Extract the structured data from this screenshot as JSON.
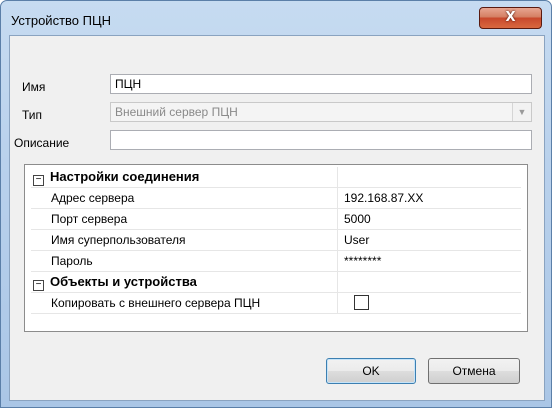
{
  "window": {
    "title": "Устройство ПЦН",
    "close_glyph": "X",
    "close_icon": "close-icon"
  },
  "form": {
    "name_label": "Имя",
    "name_value": "ПЦН",
    "type_label": "Тип",
    "type_value": "Внешний сервер ПЦН",
    "dropdown_glyph": "▼",
    "description_label": "Описание",
    "description_value": ""
  },
  "properties": {
    "categories": [
      {
        "toggle": "−",
        "title": "Настройки соединения"
      },
      {
        "toggle": "−",
        "title": "Объекты и устройства"
      }
    ],
    "connection_rows": [
      {
        "name": "Адрес сервера",
        "value": "192.168.87.XX"
      },
      {
        "name": "Порт сервера",
        "value": "5000"
      },
      {
        "name": "Имя суперпользователя",
        "value": "User"
      },
      {
        "name": "Пароль",
        "value": "********"
      }
    ],
    "objects_rows": [
      {
        "name": "Копировать с внешнего сервера ПЦН",
        "value_type": "checkbox",
        "checked": false
      }
    ]
  },
  "buttons": {
    "ok": "OK",
    "cancel": "Отмена"
  },
  "colors": {
    "title_gradient": "#b9d1ec",
    "close_button": "#c8482c",
    "client_bg": "#f0f0f0"
  }
}
